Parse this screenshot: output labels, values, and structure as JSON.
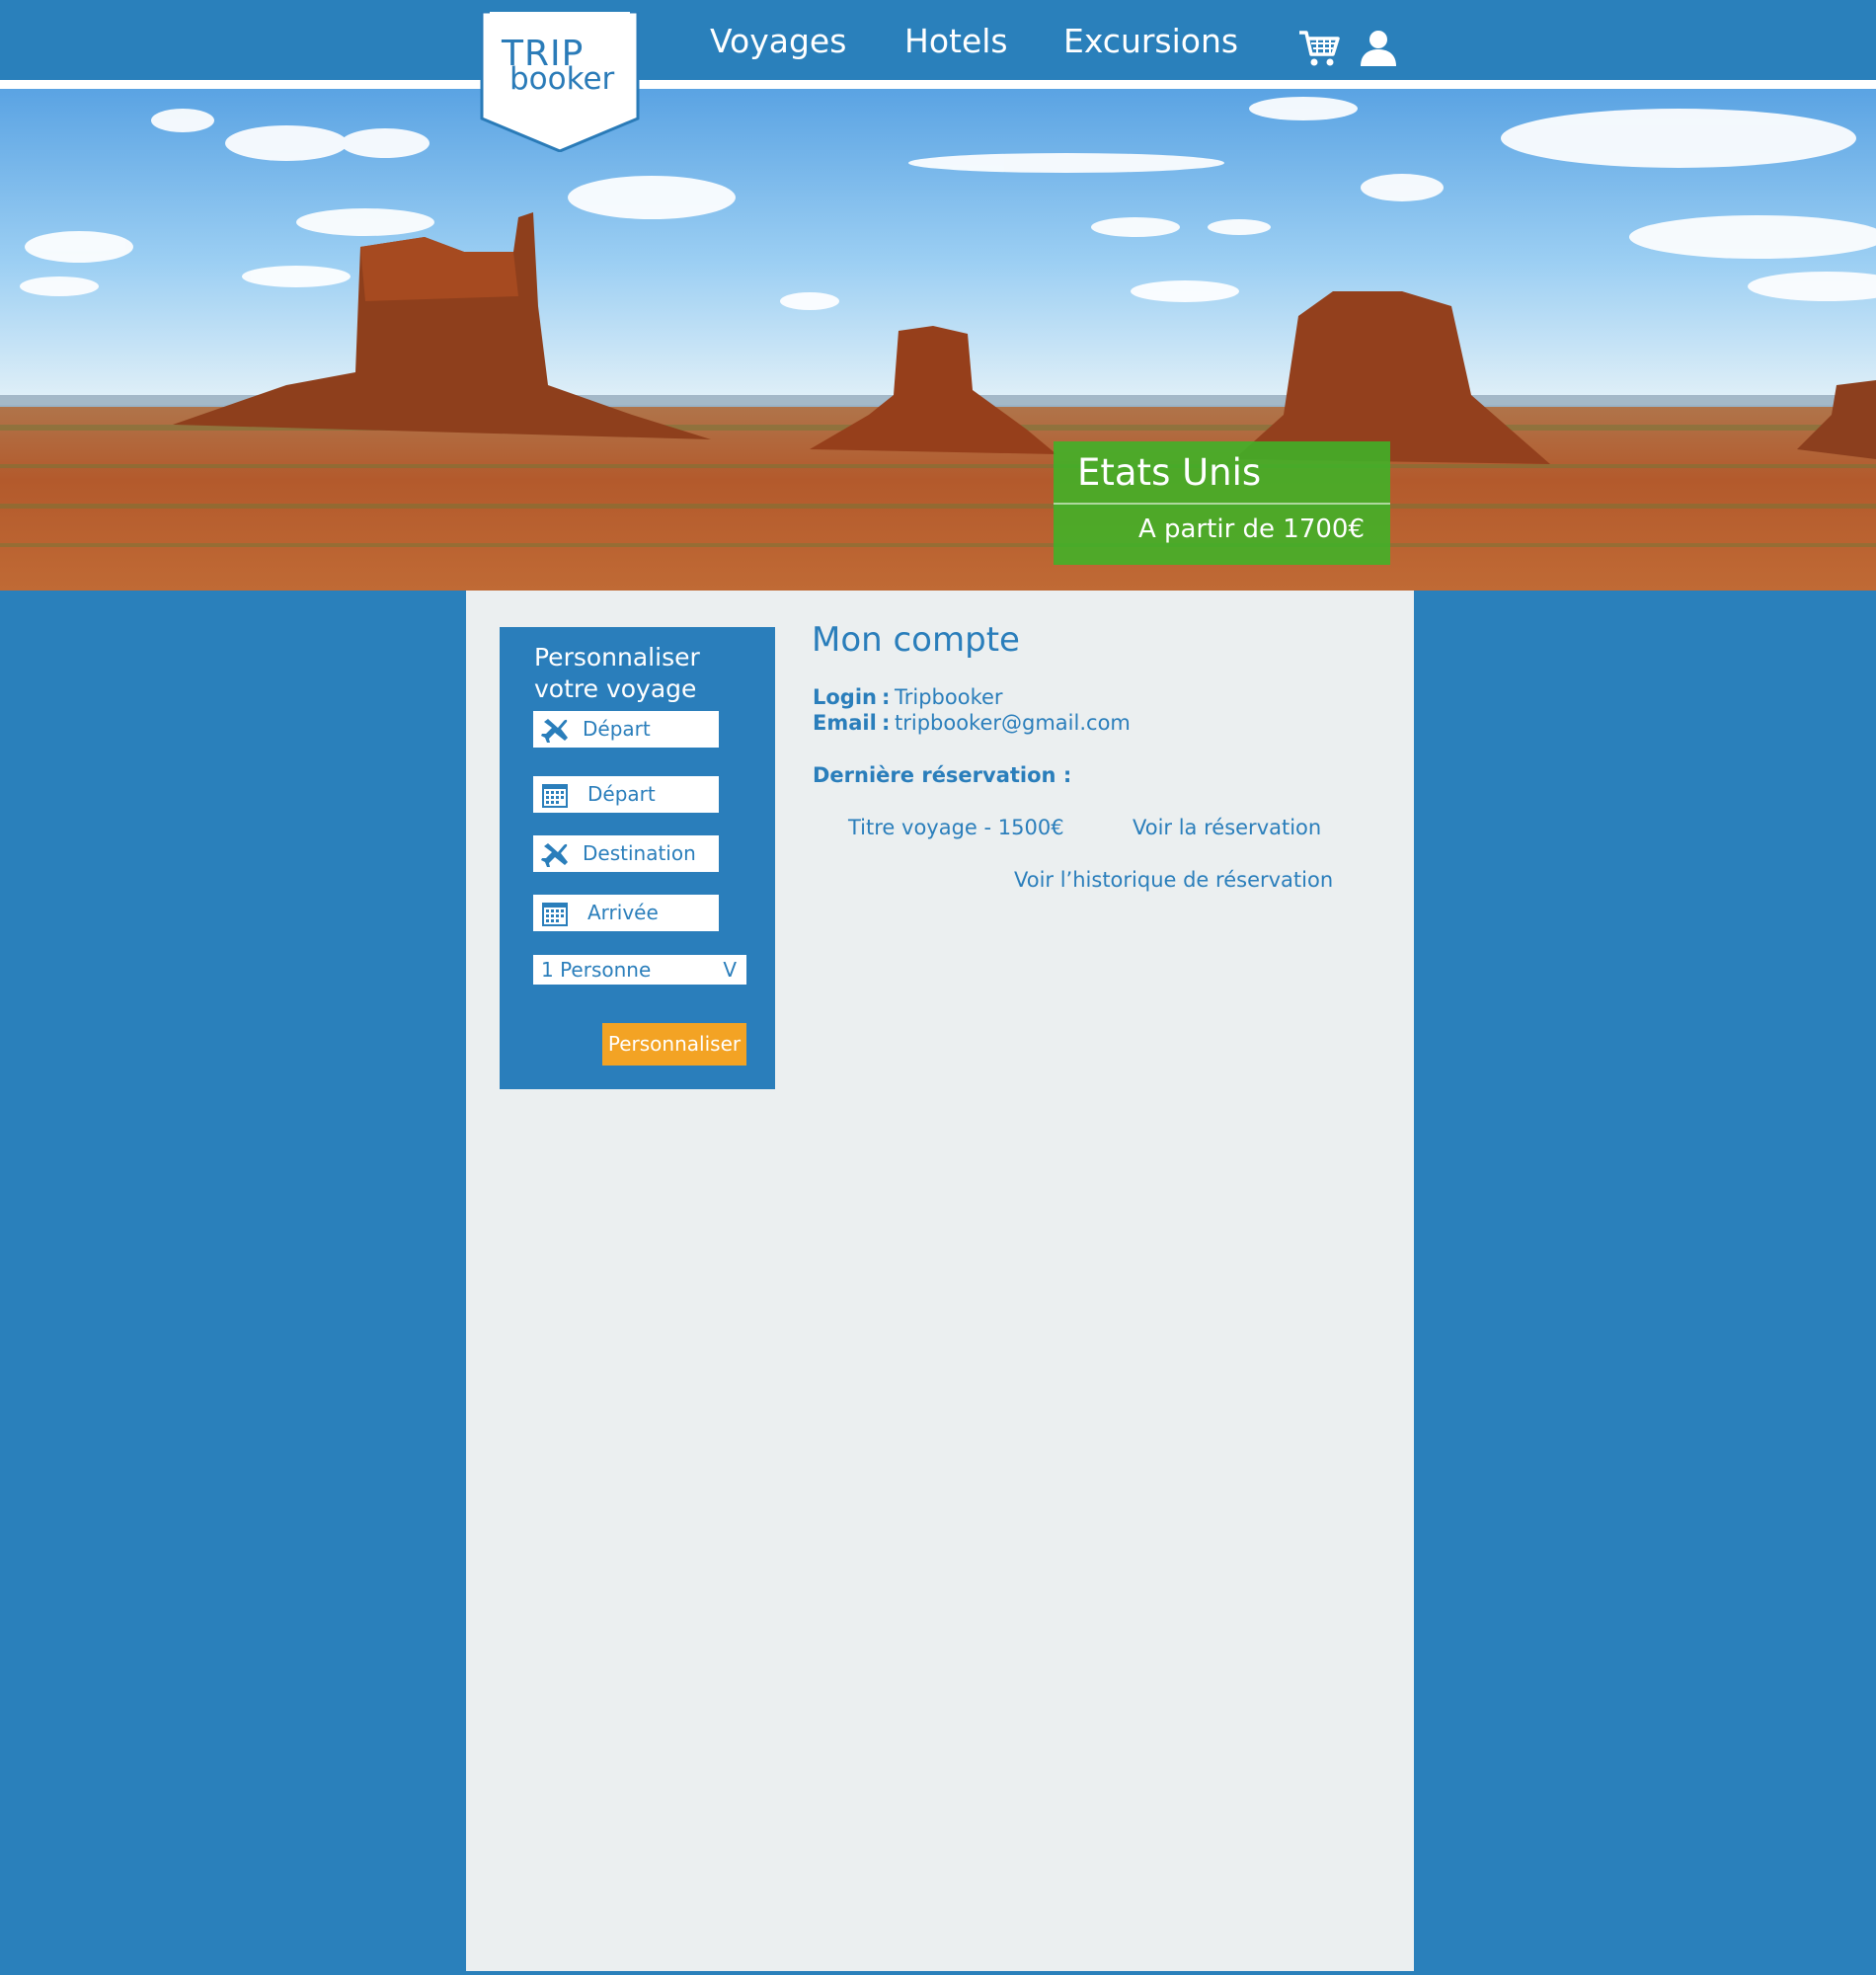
{
  "header": {
    "logo": {
      "line1": "TRIP",
      "line2": "booker"
    },
    "nav": [
      {
        "label": "Voyages"
      },
      {
        "label": "Hotels"
      },
      {
        "label": "Excursions"
      }
    ],
    "icons": {
      "cart": "cart-icon",
      "user": "user-icon"
    }
  },
  "hero": {
    "destination": "Etats Unis",
    "price": "A partir de 1700€",
    "promo_color": "#3cb428"
  },
  "sidebar": {
    "title": "Personnaliser votre voyage",
    "fields": [
      {
        "icon": "plane-icon",
        "label": "Départ"
      },
      {
        "icon": "calendar-icon",
        "label": "Départ"
      },
      {
        "icon": "plane-icon",
        "label": "Destination"
      },
      {
        "icon": "calendar-icon",
        "label": "Arrivée"
      }
    ],
    "persons": {
      "value": "1 Personne",
      "chevron": "V"
    },
    "submit_label": "Personnaliser"
  },
  "account": {
    "title": "Mon compte",
    "login_label": "Login",
    "login_value": "Tripbooker",
    "email_label": "Email",
    "email_value": "tripbooker@gmail.com",
    "separator": ":",
    "last_reservation_label": "Dernière réservation :",
    "reservation_title": "Titre voyage - 1500€",
    "view_reservation": "Voir la réservation",
    "view_history": "Voir l’historique de réservation"
  },
  "colors": {
    "brand_blue": "#2a80bb",
    "panel_bg": "#ebeff0",
    "accent_orange": "#f3a324"
  }
}
